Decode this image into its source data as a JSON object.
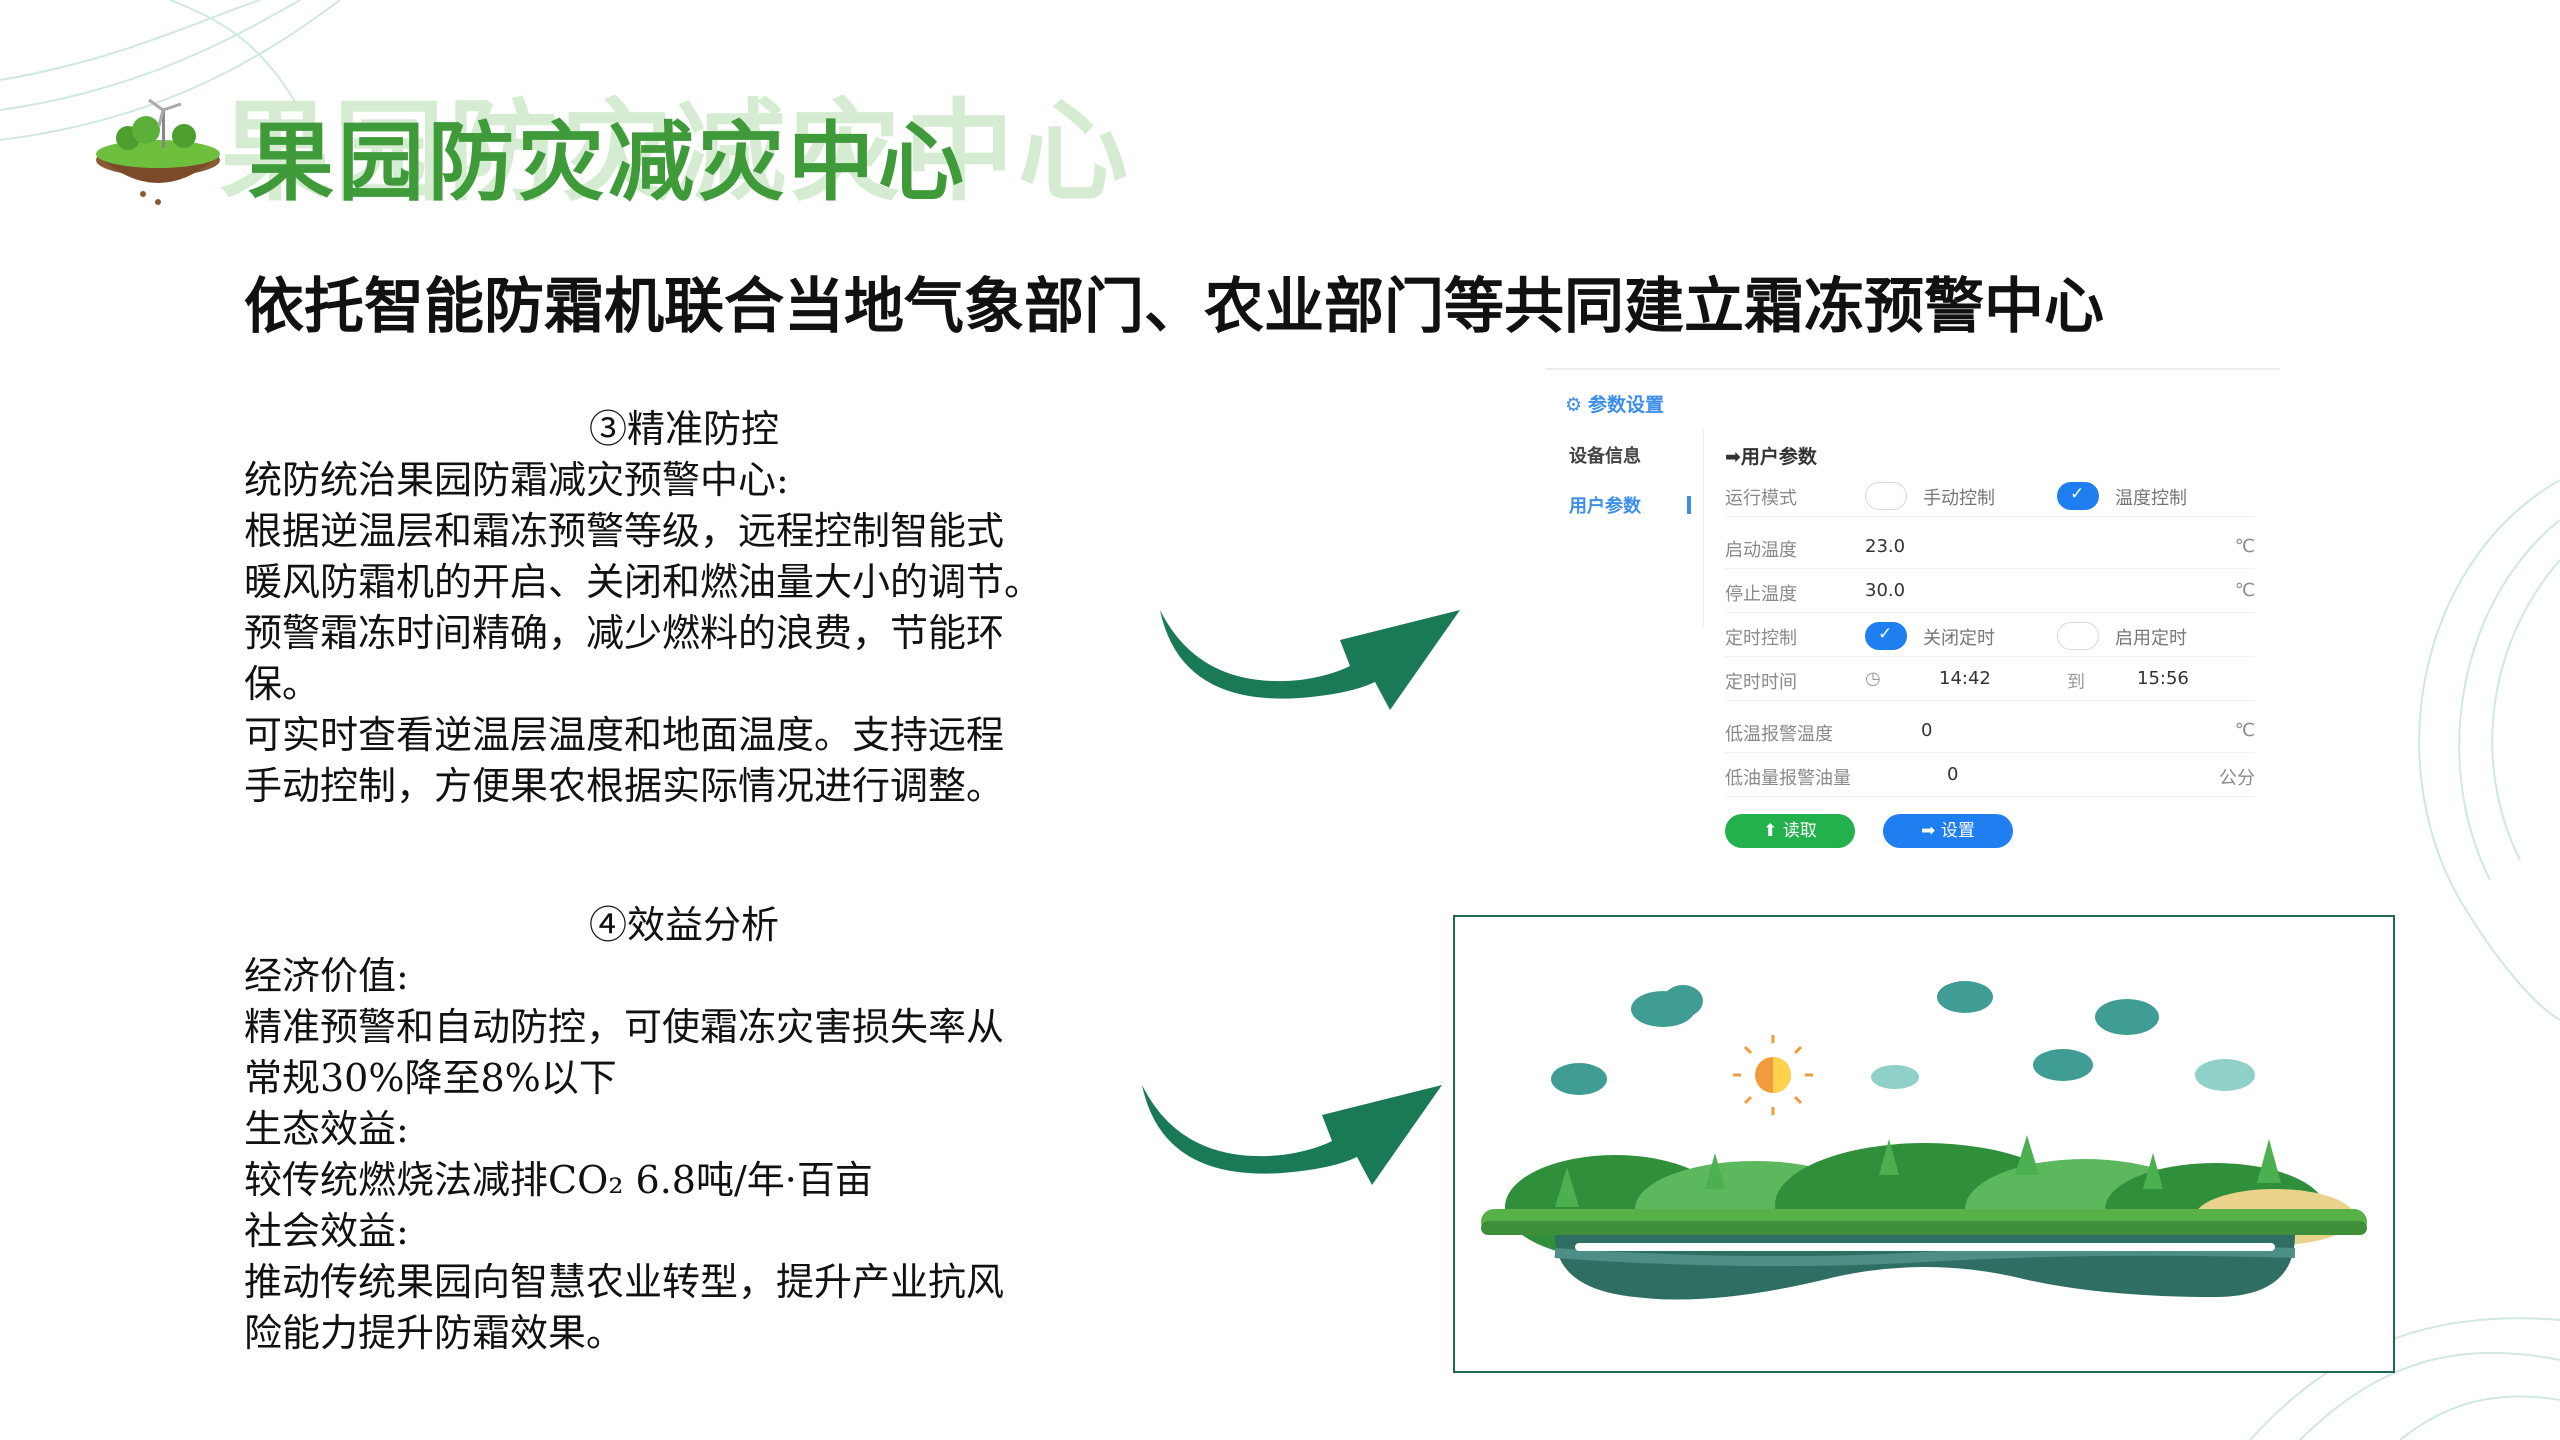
{
  "header": {
    "title": "果园防灾减灾中心",
    "subtitle": "依托智能防霜机联合当地气象部门、农业部门等共同建立霜冻预警中心"
  },
  "section_precise": {
    "heading": "③精准防控",
    "lines": [
      "统防统治果园防霜减灾预警中心:",
      "根据逆温层和霜冻预警等级，远程控制智能式",
      "暖风防霜机的开启、关闭和燃油量大小的调节。",
      "预警霜冻时间精确，减少燃料的浪费，节能环",
      "保。",
      "可实时查看逆温层温度和地面温度。支持远程",
      "手动控制，方便果农根据实际情况进行调整。"
    ]
  },
  "section_benefit": {
    "heading": "④效益分析",
    "lines": [
      "经济价值:",
      "精准预警和自动防控，可使霜冻灾害损失率从",
      "常规30%降至8%以下",
      "生态效益:",
      "较传统燃烧法减排CO₂ 6.8吨/年·百亩",
      "社会效益:",
      "推动传统果园向智慧农业转型，提升产业抗风",
      "险能力提升防霜效果。"
    ]
  },
  "settings_panel": {
    "title": "参数设置",
    "sidebar": [
      "设备信息",
      "用户参数"
    ],
    "section_title": "➡用户参数",
    "mode_label": "运行模式",
    "mode_options": [
      {
        "label": "手动控制",
        "selected": false
      },
      {
        "label": "温度控制",
        "selected": true
      }
    ],
    "start_temp_label": "启动温度",
    "start_temp_value": "23.0",
    "stop_temp_label": "停止温度",
    "stop_temp_value": "30.0",
    "temp_unit": "℃",
    "timer_label": "定时控制",
    "timer_options": [
      {
        "label": "关闭定时",
        "selected": true
      },
      {
        "label": "启用定时",
        "selected": false
      }
    ],
    "time_label": "定时时间",
    "time_start": "14:42",
    "time_to": "到",
    "time_end": "15:56",
    "low_temp_label": "低温报警温度",
    "low_temp_value": "0",
    "low_oil_label": "低油量报警油量",
    "low_oil_value": "0",
    "oil_unit": "公分",
    "read_button": "读取",
    "set_button": "设置"
  },
  "colors": {
    "title_green": "#3f9b3a",
    "arrow_green": "#1a7a55",
    "panel_blue": "#1f7ff0",
    "read_green": "#22b14c"
  }
}
